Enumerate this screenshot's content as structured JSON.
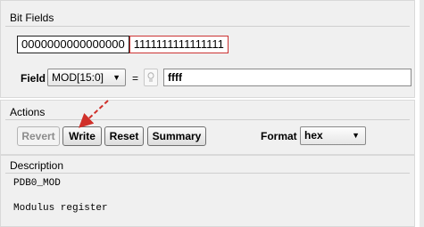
{
  "bit_fields": {
    "title": "Bit Fields",
    "bits_low": "0000000000000000",
    "bits_high": "1111111111111111",
    "field_label": "Field",
    "field_selected": "MOD[15:0]",
    "equals": "=",
    "hint_icon": "bulb-icon",
    "value": "ffff"
  },
  "actions": {
    "title": "Actions",
    "revert_label": "Revert",
    "write_label": "Write",
    "reset_label": "Reset",
    "summary_label": "Summary",
    "format_label": "Format",
    "format_selected": "hex"
  },
  "description": {
    "title": "Description",
    "text": "PDB0_MOD\n\nModulus register"
  },
  "colors": {
    "highlight_border": "#cc3333",
    "arrow": "#d0302a"
  }
}
